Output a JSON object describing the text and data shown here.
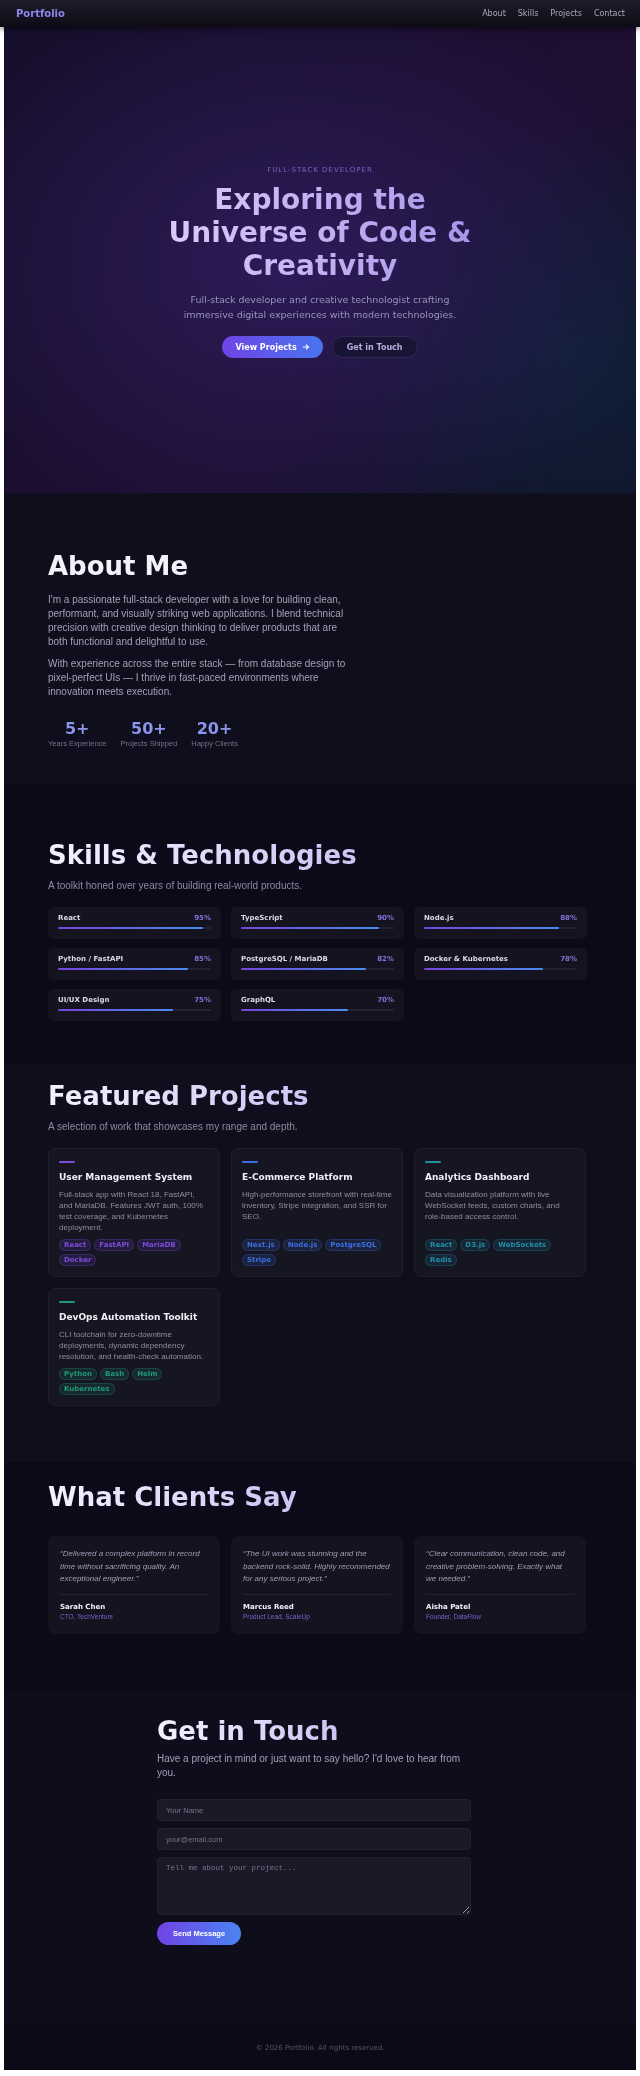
{
  "nav": {
    "logo": "Portfolio",
    "links": [
      "About",
      "Skills",
      "Projects",
      "Contact"
    ]
  },
  "hero": {
    "eyebrow": "FULL-STACK DEVELOPER",
    "title": "Exploring the Universe of Code & Creativity",
    "subtitle": "Full-stack developer and creative technologist crafting immersive digital experiences with modern technologies.",
    "buttons": [
      {
        "label": "View Projects",
        "kind": "primary"
      },
      {
        "label": "Get in Touch",
        "kind": "secondary"
      }
    ]
  },
  "about": {
    "title": "About Me",
    "paragraphs": [
      "I'm a passionate full-stack developer with a love for building clean, performant, and visually striking web applications. I blend technical precision with creative design thinking to deliver products that are both functional and delightful to use.",
      "With experience across the entire stack — from database design to pixel-perfect UIs — I thrive in fast-paced environments where innovation meets execution."
    ],
    "stats": [
      {
        "value": "5+",
        "label": "Years Experience"
      },
      {
        "value": "50+",
        "label": "Projects Shipped"
      },
      {
        "value": "20+",
        "label": "Happy Clients"
      }
    ]
  },
  "skills": {
    "title": "Skills & Technologies",
    "subtitle": "A toolkit honed over years of building real-world products.",
    "items": [
      {
        "name": "React",
        "reading": "95%",
        "level": 0.95
      },
      {
        "name": "TypeScript",
        "reading": "90%",
        "level": 0.9
      },
      {
        "name": "Node.js",
        "reading": "88%",
        "level": 0.88
      },
      {
        "name": "Python / FastAPI",
        "reading": "85%",
        "level": 0.85
      },
      {
        "name": "PostgreSQL / MariaDB",
        "reading": "82%",
        "level": 0.82
      },
      {
        "name": "Docker & Kubernetes",
        "reading": "78%",
        "level": 0.78
      },
      {
        "name": "UI/UX Design",
        "reading": "75%",
        "level": 0.75
      },
      {
        "name": "GraphQL",
        "reading": "70%",
        "level": 0.7
      }
    ]
  },
  "projects": {
    "title": "Featured Projects",
    "subtitle": "A selection of work that showcases my range and depth.",
    "items": [
      {
        "title": "User Management System",
        "description": "Full-stack app with React 18, FastAPI, and MariaDB. Features JWT auth, 100% test coverage, and Kubernetes deployment.",
        "color": "#7c4ddb",
        "tags": [
          "React",
          "FastAPI",
          "MariaDB",
          "Docker"
        ]
      },
      {
        "title": "E-Commerce Platform",
        "description": "High-performance storefront with real-time inventory, Stripe integration, and SSR for SEO.",
        "color": "#3b6fe0",
        "tags": [
          "Next.js",
          "Node.js",
          "PostgreSQL",
          "Stripe"
        ]
      },
      {
        "title": "Analytics Dashboard",
        "description": "Data visualization platform with live WebSocket feeds, custom charts, and role-based access control.",
        "color": "#1f8fa8",
        "tags": [
          "React",
          "D3.js",
          "WebSockets",
          "Redis"
        ]
      },
      {
        "title": "DevOps Automation Toolkit",
        "description": "CLI toolchain for zero-downtime deployments, dynamic dependency resolution, and health-check automation.",
        "color": "#1f9a78",
        "tags": [
          "Python",
          "Bash",
          "Helm",
          "Kubernetes"
        ]
      }
    ]
  },
  "testimonials": {
    "title": "What Clients Say",
    "items": [
      {
        "quote": "“Delivered a complex platform in record time without sacrificing quality. An exceptional engineer.”",
        "name": "Sarah Chen",
        "role": "CTO, TechVenture"
      },
      {
        "quote": "“The UI work was stunning and the backend rock-solid. Highly recommended for any serious project.”",
        "name": "Marcus Reed",
        "role": "Product Lead, ScaleUp"
      },
      {
        "quote": "“Clear communication, clean code, and creative problem-solving. Exactly what we needed.”",
        "name": "Aisha Patel",
        "role": "Founder, DataFlow"
      }
    ]
  },
  "contact": {
    "title": "Get in Touch",
    "subtitle": "Have a project in mind or just want to say hello? I'd love to hear from you.",
    "fields": [
      {
        "kind": "text",
        "placeholder": "Your Name"
      },
      {
        "kind": "email",
        "placeholder": "your@email.com"
      },
      {
        "kind": "textarea",
        "placeholder": "Tell me about your project..."
      }
    ],
    "button": "Send Message"
  },
  "footer": {
    "text": "© 2026 Portfolio. All rights reserved."
  }
}
